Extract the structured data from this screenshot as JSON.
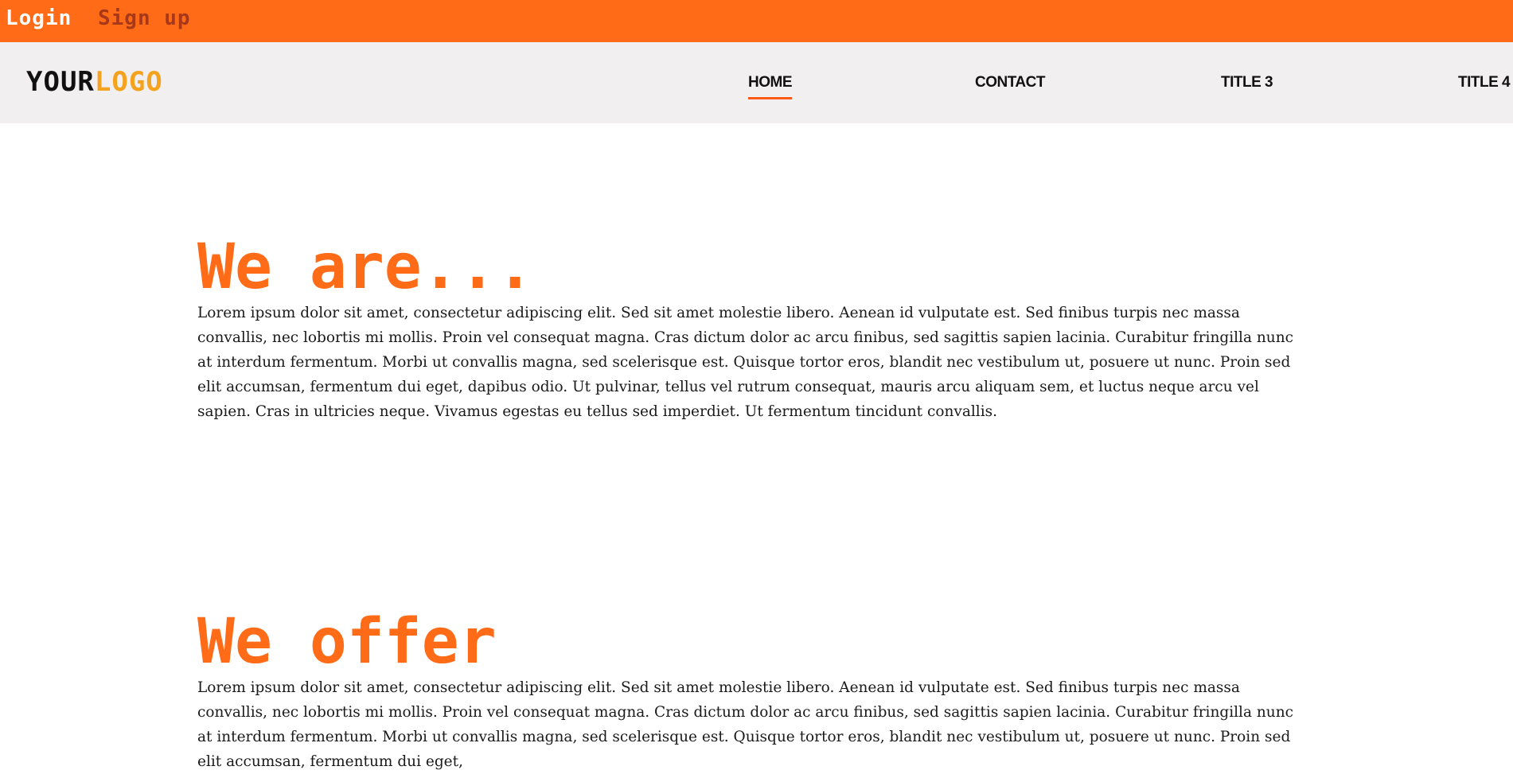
{
  "topbar": {
    "login_label": "Login",
    "signup_label": "Sign up"
  },
  "colors": {
    "accent": "#ff6b17",
    "logo_accent": "#f5a31f",
    "navbar_bg": "#f1eff0",
    "signup_text": "#a8381a"
  },
  "header": {
    "logo_your": "YOUR",
    "logo_logo": "LOGO",
    "nav": [
      {
        "label": "HOME",
        "active": true
      },
      {
        "label": "CONTACT",
        "active": false
      },
      {
        "label": "TITLE 3",
        "active": false
      },
      {
        "label": "TITLE 4",
        "active": false
      }
    ]
  },
  "sections": [
    {
      "heading": "We are...",
      "body": "Lorem ipsum dolor sit amet, consectetur adipiscing elit. Sed sit amet molestie libero. Aenean id vulputate est. Sed finibus turpis nec massa convallis, nec lobortis mi mollis. Proin vel consequat magna. Cras dictum dolor ac arcu finibus, sed sagittis sapien lacinia. Curabitur fringilla nunc at interdum fermentum. Morbi ut convallis magna, sed scelerisque est. Quisque tortor eros, blandit nec vestibulum ut, posuere ut nunc. Proin sed elit accumsan, fermentum dui eget, dapibus odio. Ut pulvinar, tellus vel rutrum consequat, mauris arcu aliquam sem, et luctus neque arcu vel sapien. Cras in ultricies neque. Vivamus egestas eu tellus sed imperdiet. Ut fermentum tincidunt convallis."
    },
    {
      "heading": "We offer",
      "body": "Lorem ipsum dolor sit amet, consectetur adipiscing elit. Sed sit amet molestie libero. Aenean id vulputate est. Sed finibus turpis nec massa convallis, nec lobortis mi mollis. Proin vel consequat magna. Cras dictum dolor ac arcu finibus, sed sagittis sapien lacinia. Curabitur fringilla nunc at interdum fermentum. Morbi ut convallis magna, sed scelerisque est. Quisque tortor eros, blandit nec vestibulum ut, posuere ut nunc. Proin sed elit accumsan, fermentum dui eget,"
    }
  ]
}
